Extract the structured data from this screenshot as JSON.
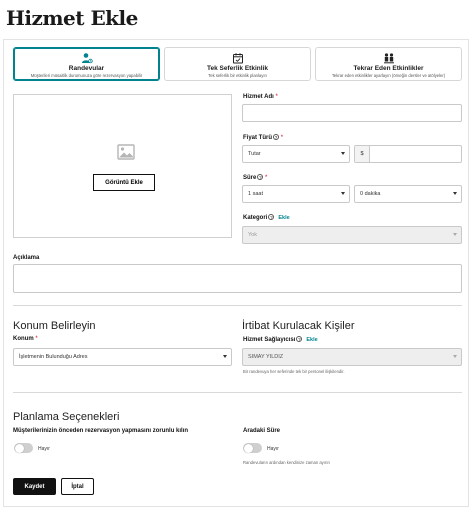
{
  "page": {
    "title": "Hizmet Ekle"
  },
  "service_types": [
    {
      "title": "Randevular",
      "subtitle": "Müşterileri müsaitlik durumunuza göre rezervasyon yapabilir",
      "icon": "people-icon",
      "active": true
    },
    {
      "title": "Tek Seferlik Etkinlik",
      "subtitle": "Tek seferlik bir etkinlik planlayın",
      "icon": "calendar-check-icon",
      "active": false
    },
    {
      "title": "Tekrar Eden Etkinlikler",
      "subtitle": "Tekrar eden etkinlikler ayarlayın (örneğin dersler ve atölyeler)",
      "icon": "group-icon",
      "active": false
    }
  ],
  "image": {
    "button_label": "Görüntü Ekle",
    "icon": "image-placeholder-icon"
  },
  "form": {
    "service_name": {
      "label": "Hizmet Adı",
      "required_mark": "*",
      "value": ""
    },
    "price_type": {
      "label": "Fiyat Türü",
      "required_mark": "*",
      "selected": "Tutar",
      "currency_symbol": "$",
      "amount": ""
    },
    "duration": {
      "label": "Süre",
      "required_mark": "*",
      "hours": "1 saat",
      "minutes": "0 dakika"
    },
    "category": {
      "label": "Kategori",
      "add_label": "Ekle",
      "selected": "Yok"
    },
    "description": {
      "label": "Açıklama",
      "value": ""
    }
  },
  "location": {
    "section_title": "Konum Belirleyin",
    "label": "Konum",
    "required_mark": "*",
    "selected": "İşletmenin Bulunduğu Adres"
  },
  "contact": {
    "section_title": "İrtibat Kurulacak Kişiler",
    "label": "Hizmet Sağlayıcısı",
    "add_label": "Ekle",
    "selected": "SIMAY YILDIZ",
    "hint": "Bir randevuya her seferinde tek bir personel ilişkilendir."
  },
  "scheduling": {
    "section_title": "Planlama Seçenekleri",
    "advance_booking": {
      "label": "Müşterilerinizin önceden rezervasyon yapmasını zorunlu kılın",
      "toggle_label": "Hayır",
      "enabled": false
    },
    "buffer": {
      "label": "Aradaki Süre",
      "toggle_label": "Hayır",
      "enabled": false,
      "hint": "Randevuların ardından kendinize zaman ayırın"
    }
  },
  "actions": {
    "save_label": "Kaydet",
    "cancel_label": "İptal"
  },
  "colors": {
    "accent": "#00838f",
    "primary_button": "#111111",
    "required": "#d0021b"
  }
}
